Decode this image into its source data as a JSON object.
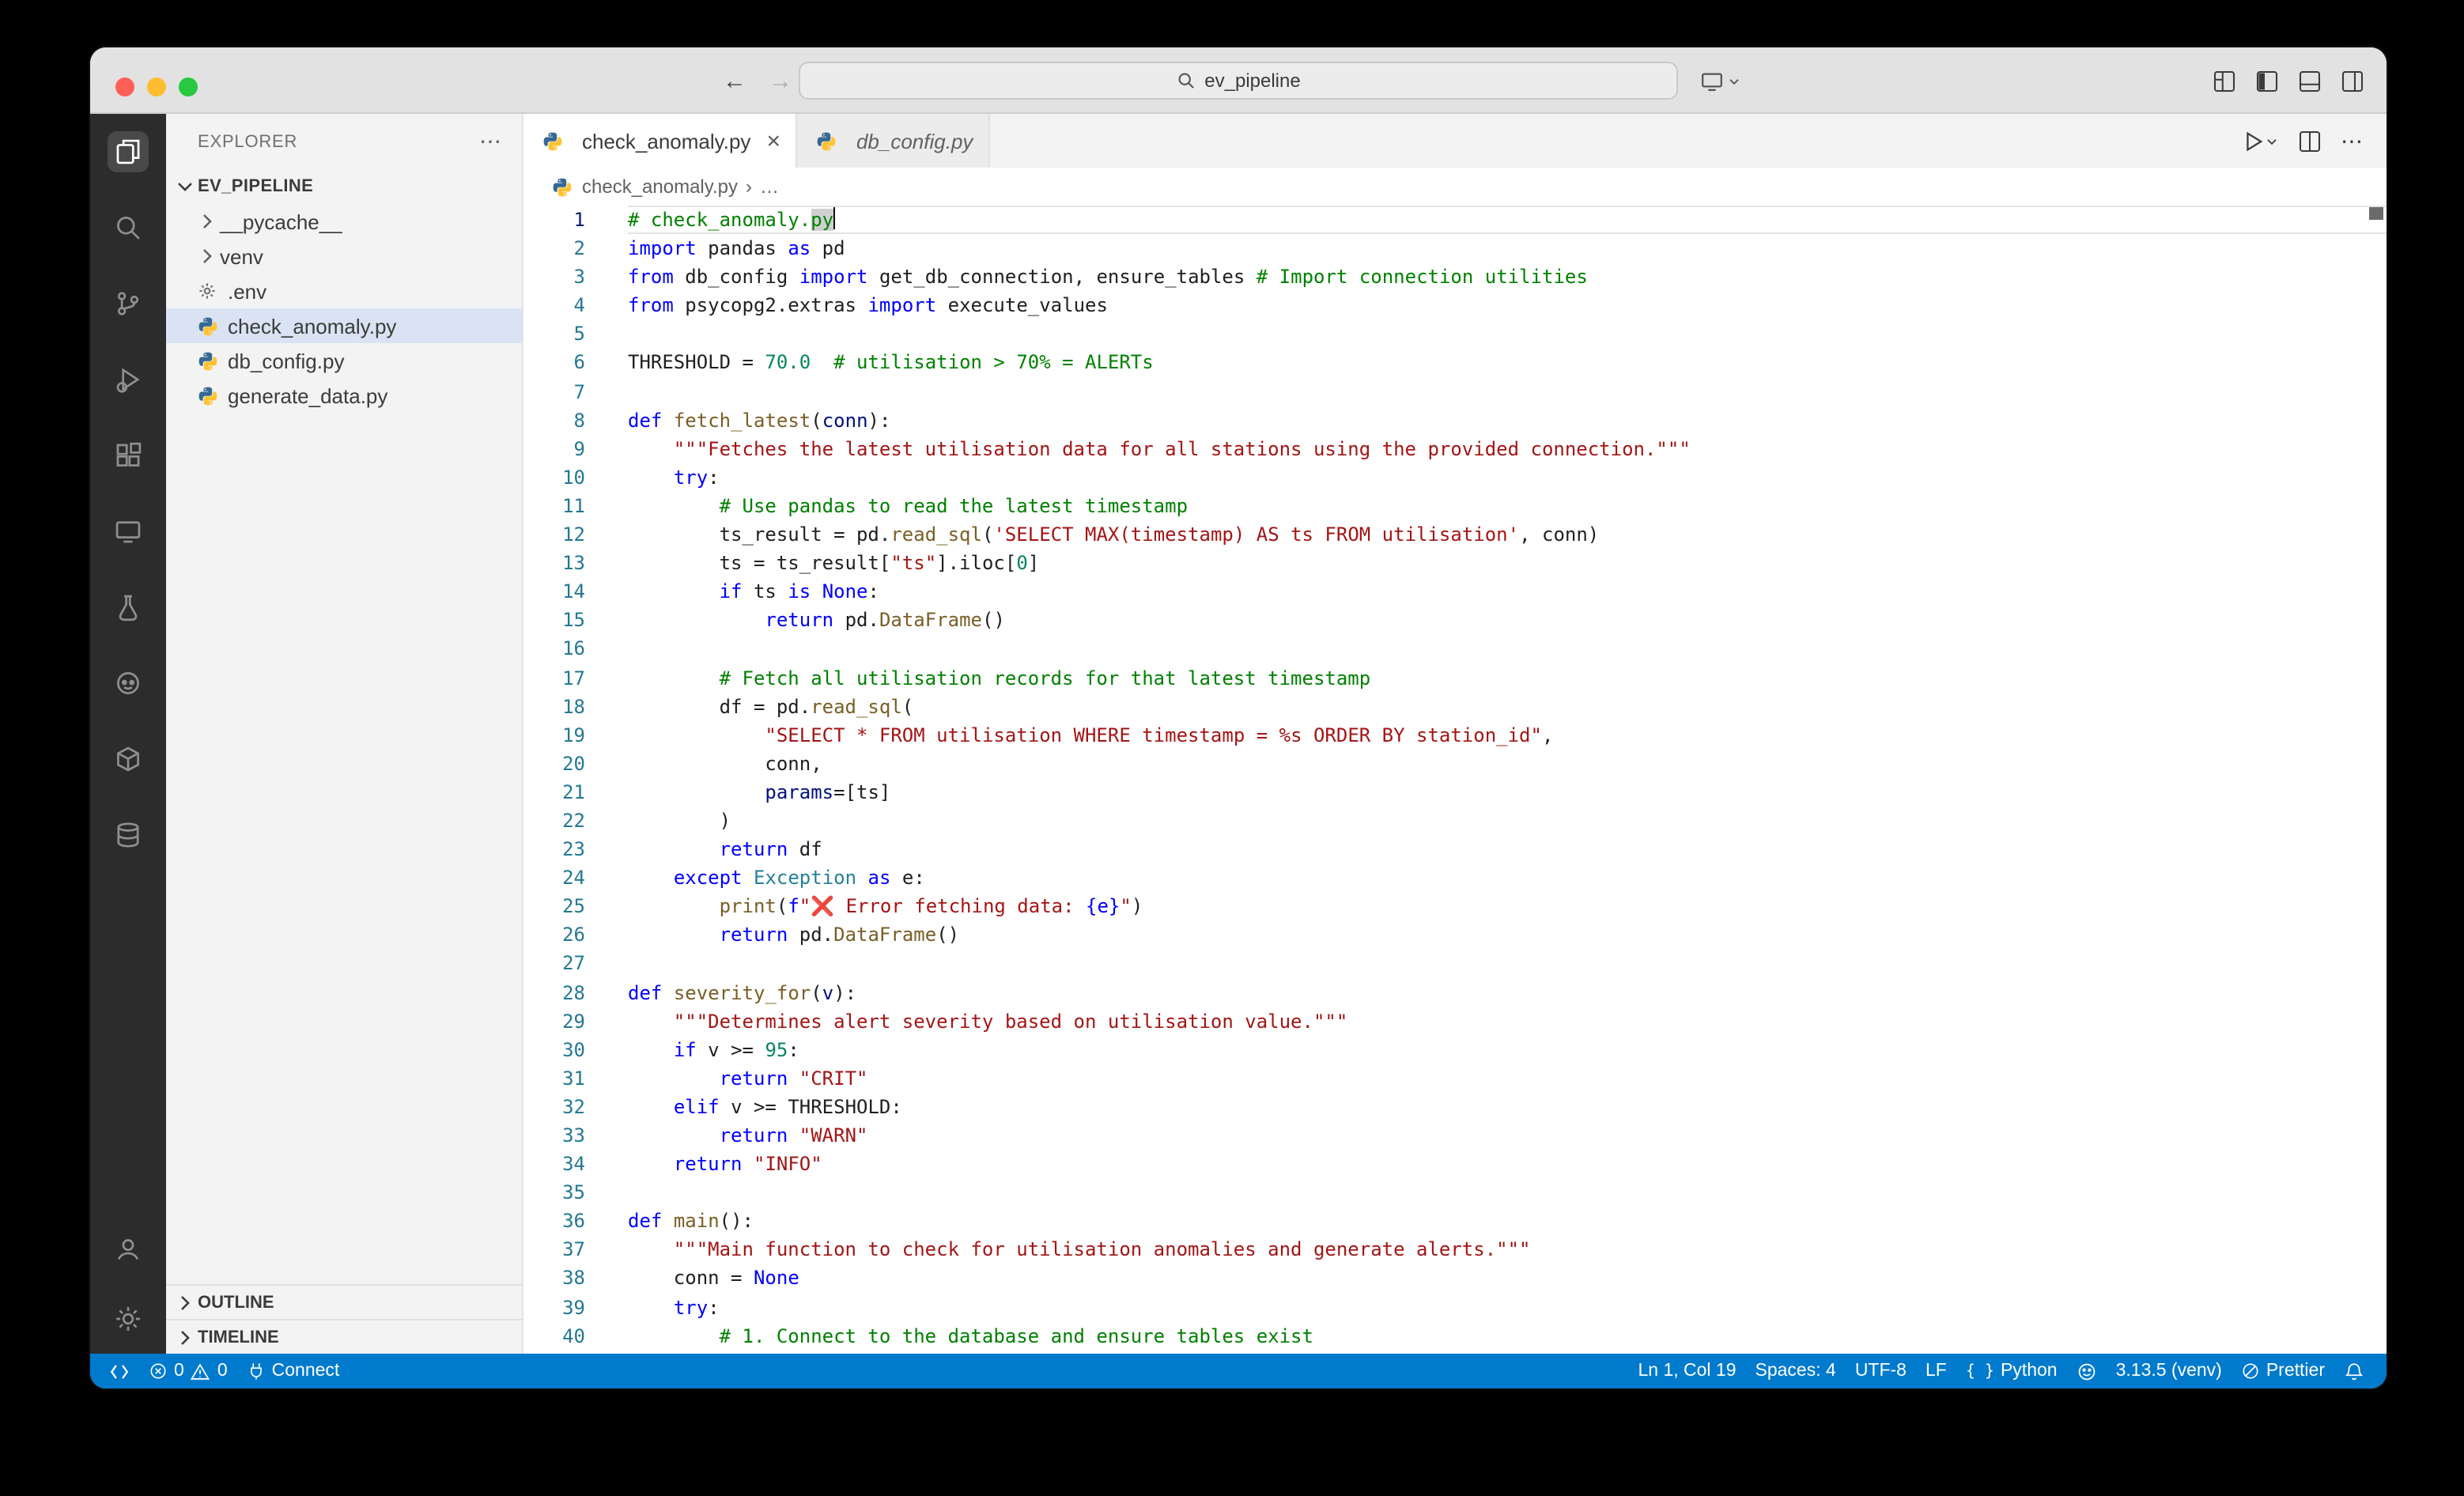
{
  "titlebar": {
    "search_value": "ev_pipeline"
  },
  "tabs": [
    {
      "label": "check_anomaly.py",
      "state": "active"
    },
    {
      "label": "db_config.py",
      "state": "preview"
    }
  ],
  "breadcrumb": {
    "file": "check_anomaly.py",
    "separator": "›",
    "ellipsis": "…"
  },
  "explorer": {
    "title": "EXPLORER",
    "root": "EV_PIPELINE",
    "items": [
      {
        "label": "__pycache__",
        "kind": "folder"
      },
      {
        "label": "venv",
        "kind": "folder"
      },
      {
        "label": ".env",
        "kind": "env"
      },
      {
        "label": "check_anomaly.py",
        "kind": "python",
        "selected": true
      },
      {
        "label": "db_config.py",
        "kind": "python"
      },
      {
        "label": "generate_data.py",
        "kind": "python"
      }
    ],
    "sections": [
      {
        "label": "OUTLINE"
      },
      {
        "label": "TIMELINE"
      }
    ]
  },
  "editor": {
    "current_line": 1,
    "lines": [
      [
        [
          "c",
          "# check_anomaly."
        ],
        [
          "c sel",
          "py"
        ],
        [
          "cursor",
          ""
        ]
      ],
      [
        [
          "k",
          "import"
        ],
        [
          "t",
          " pandas "
        ],
        [
          "k",
          "as"
        ],
        [
          "t",
          " pd"
        ]
      ],
      [
        [
          "k",
          "from"
        ],
        [
          "t",
          " db_config "
        ],
        [
          "k",
          "import"
        ],
        [
          "t",
          " get_db_connection, ensure_tables "
        ],
        [
          "c",
          "# Import connection utilities"
        ]
      ],
      [
        [
          "k",
          "from"
        ],
        [
          "t",
          " psycopg2.extras "
        ],
        [
          "k",
          "import"
        ],
        [
          "t",
          " execute_values"
        ]
      ],
      [],
      [
        [
          "t",
          "THRESHOLD = "
        ],
        [
          "n",
          "70.0"
        ],
        [
          "t",
          "  "
        ],
        [
          "c",
          "# utilisation > 70% = ALERTs"
        ]
      ],
      [],
      [
        [
          "k",
          "def"
        ],
        [
          "t",
          " "
        ],
        [
          "f",
          "fetch_latest"
        ],
        [
          "t",
          "("
        ],
        [
          "v",
          "conn"
        ],
        [
          "t",
          "):"
        ]
      ],
      [
        [
          "s",
          "    \"\"\"Fetches the latest utilisation data for all stations using the provided connection.\"\"\""
        ]
      ],
      [
        [
          "t",
          "    "
        ],
        [
          "k",
          "try"
        ],
        [
          "t",
          ":"
        ]
      ],
      [
        [
          "c",
          "        # Use pandas to read the latest timestamp"
        ]
      ],
      [
        [
          "t",
          "        ts_result = pd."
        ],
        [
          "f",
          "read_sql"
        ],
        [
          "t",
          "("
        ],
        [
          "s",
          "'SELECT MAX(timestamp) AS ts FROM utilisation'"
        ],
        [
          "t",
          ", conn)"
        ]
      ],
      [
        [
          "t",
          "        ts = ts_result["
        ],
        [
          "s",
          "\"ts\""
        ],
        [
          "t",
          "].iloc["
        ],
        [
          "n",
          "0"
        ],
        [
          "t",
          "]"
        ]
      ],
      [
        [
          "t",
          "        "
        ],
        [
          "k",
          "if"
        ],
        [
          "t",
          " ts "
        ],
        [
          "k",
          "is"
        ],
        [
          "t",
          " "
        ],
        [
          "k",
          "None"
        ],
        [
          "t",
          ":"
        ]
      ],
      [
        [
          "t",
          "            "
        ],
        [
          "k",
          "return"
        ],
        [
          "t",
          " pd."
        ],
        [
          "f",
          "DataFrame"
        ],
        [
          "t",
          "()"
        ]
      ],
      [],
      [
        [
          "c",
          "        # Fetch all utilisation records for that latest timestamp"
        ]
      ],
      [
        [
          "t",
          "        df = pd."
        ],
        [
          "f",
          "read_sql"
        ],
        [
          "t",
          "("
        ]
      ],
      [
        [
          "t",
          "            "
        ],
        [
          "s",
          "\"SELECT * FROM utilisation WHERE timestamp = %s ORDER BY station_id\""
        ],
        [
          "t",
          ","
        ]
      ],
      [
        [
          "t",
          "            conn,"
        ]
      ],
      [
        [
          "t",
          "            "
        ],
        [
          "v",
          "params"
        ],
        [
          "t",
          "=[ts]"
        ]
      ],
      [
        [
          "t",
          "        )"
        ]
      ],
      [
        [
          "t",
          "        "
        ],
        [
          "k",
          "return"
        ],
        [
          "t",
          " df"
        ]
      ],
      [
        [
          "t",
          "    "
        ],
        [
          "k",
          "except"
        ],
        [
          "t",
          " "
        ],
        [
          "cl",
          "Exception"
        ],
        [
          "t",
          " "
        ],
        [
          "k",
          "as"
        ],
        [
          "t",
          " e:"
        ]
      ],
      [
        [
          "t",
          "        "
        ],
        [
          "f",
          "print"
        ],
        [
          "t",
          "("
        ],
        [
          "k",
          "f"
        ],
        [
          "s",
          "\"❌ Error fetching data: "
        ],
        [
          "k",
          "{e}"
        ],
        [
          "s",
          "\""
        ],
        [
          "t",
          ")"
        ]
      ],
      [
        [
          "t",
          "        "
        ],
        [
          "k",
          "return"
        ],
        [
          "t",
          " pd."
        ],
        [
          "f",
          "DataFrame"
        ],
        [
          "t",
          "()"
        ]
      ],
      [],
      [
        [
          "k",
          "def"
        ],
        [
          "t",
          " "
        ],
        [
          "f",
          "severity_for"
        ],
        [
          "t",
          "("
        ],
        [
          "v",
          "v"
        ],
        [
          "t",
          "):"
        ]
      ],
      [
        [
          "s",
          "    \"\"\"Determines alert severity based on utilisation value.\"\"\""
        ]
      ],
      [
        [
          "t",
          "    "
        ],
        [
          "k",
          "if"
        ],
        [
          "t",
          " v >= "
        ],
        [
          "n",
          "95"
        ],
        [
          "t",
          ":"
        ]
      ],
      [
        [
          "t",
          "        "
        ],
        [
          "k",
          "return"
        ],
        [
          "t",
          " "
        ],
        [
          "s",
          "\"CRIT\""
        ]
      ],
      [
        [
          "t",
          "    "
        ],
        [
          "k",
          "elif"
        ],
        [
          "t",
          " v >= THRESHOLD:"
        ]
      ],
      [
        [
          "t",
          "        "
        ],
        [
          "k",
          "return"
        ],
        [
          "t",
          " "
        ],
        [
          "s",
          "\"WARN\""
        ]
      ],
      [
        [
          "t",
          "    "
        ],
        [
          "k",
          "return"
        ],
        [
          "t",
          " "
        ],
        [
          "s",
          "\"INFO\""
        ]
      ],
      [],
      [
        [
          "k",
          "def"
        ],
        [
          "t",
          " "
        ],
        [
          "f",
          "main"
        ],
        [
          "t",
          "():"
        ]
      ],
      [
        [
          "s",
          "    \"\"\"Main function to check for utilisation anomalies and generate alerts.\"\"\""
        ]
      ],
      [
        [
          "t",
          "    conn = "
        ],
        [
          "k",
          "None"
        ]
      ],
      [
        [
          "t",
          "    "
        ],
        [
          "k",
          "try"
        ],
        [
          "t",
          ":"
        ]
      ],
      [
        [
          "c",
          "        # 1. Connect to the database and ensure tables exist"
        ]
      ]
    ]
  },
  "statusbar": {
    "errors": "0",
    "warnings": "0",
    "connect_label": "Connect",
    "cursor_position": "Ln 1, Col 19",
    "indentation": "Spaces: 4",
    "encoding": "UTF-8",
    "eol": "LF",
    "language": "Python",
    "interpreter": "3.13.5 (venv)",
    "formatter": "Prettier"
  },
  "colors": {
    "statusbar_bg": "#007acc",
    "close": "#ff5f57",
    "minimize": "#febc2e",
    "zoom": "#28c840",
    "python_blue": "#366994",
    "python_yellow": "#ffc331"
  }
}
